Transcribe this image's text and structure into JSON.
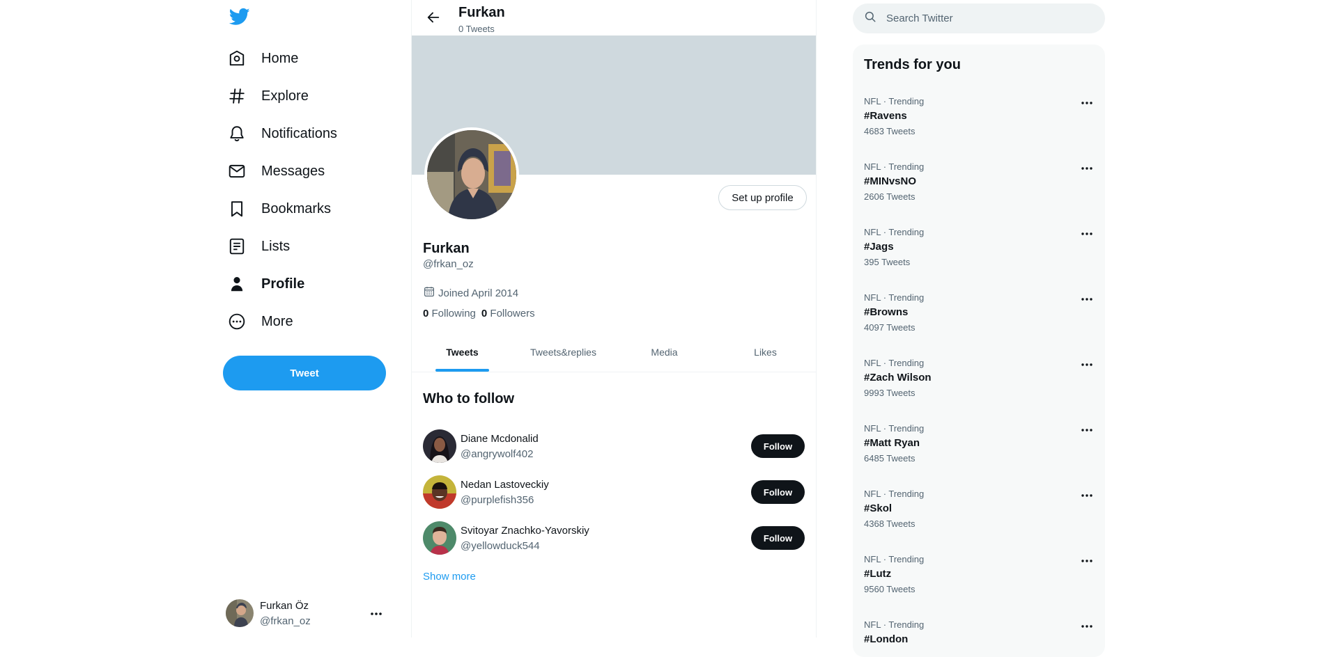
{
  "nav": {
    "items": [
      {
        "label": "Home",
        "icon": "home-icon"
      },
      {
        "label": "Explore",
        "icon": "hashtag-icon"
      },
      {
        "label": "Notifications",
        "icon": "bell-icon"
      },
      {
        "label": "Messages",
        "icon": "envelope-icon"
      },
      {
        "label": "Bookmarks",
        "icon": "bookmark-icon"
      },
      {
        "label": "Lists",
        "icon": "list-icon"
      },
      {
        "label": "Profile",
        "icon": "person-icon",
        "active": true
      },
      {
        "label": "More",
        "icon": "more-circle-icon"
      }
    ],
    "tweet_button": "Tweet"
  },
  "account": {
    "name": "Furkan Öz",
    "handle": "@frkan_oz"
  },
  "header": {
    "title": "Furkan",
    "subtitle": "0 Tweets"
  },
  "profile": {
    "setup_button": "Set up profile",
    "name": "Furkan",
    "handle": "@frkan_oz",
    "joined": "Joined April 2014",
    "following_count": "0",
    "following_label": "Following",
    "followers_count": "0",
    "followers_label": "Followers"
  },
  "tabs": [
    {
      "label": "Tweets",
      "active": true
    },
    {
      "label": "Tweets&replies"
    },
    {
      "label": "Media"
    },
    {
      "label": "Likes"
    }
  ],
  "who_to_follow": {
    "title": "Who to follow",
    "users": [
      {
        "name": "Diane Mcdonalid",
        "handle": "@angrywolf402",
        "button": "Follow"
      },
      {
        "name": "Nedan Lastoveckiy",
        "handle": "@purplefish356",
        "button": "Follow"
      },
      {
        "name": "Svitoyar Znachko-Yavorskiy",
        "handle": "@yellowduck544",
        "button": "Follow"
      }
    ],
    "show_more": "Show more"
  },
  "search": {
    "placeholder": "Search Twitter"
  },
  "trends": {
    "title": "Trends for you",
    "items": [
      {
        "meta": "NFL · Trending",
        "tag": "#Ravens",
        "count": "4683 Tweets"
      },
      {
        "meta": "NFL · Trending",
        "tag": "#MINvsNO",
        "count": "2606 Tweets"
      },
      {
        "meta": "NFL · Trending",
        "tag": "#Jags",
        "count": "395 Tweets"
      },
      {
        "meta": "NFL · Trending",
        "tag": "#Browns",
        "count": "4097 Tweets"
      },
      {
        "meta": "NFL · Trending",
        "tag": "#Zach Wilson",
        "count": "9993 Tweets"
      },
      {
        "meta": "NFL · Trending",
        "tag": "#Matt Ryan",
        "count": "6485 Tweets"
      },
      {
        "meta": "NFL · Trending",
        "tag": "#Skol",
        "count": "4368 Tweets"
      },
      {
        "meta": "NFL · Trending",
        "tag": "#Lutz",
        "count": "9560 Tweets"
      },
      {
        "meta": "NFL · Trending",
        "tag": "#London",
        "count": ""
      }
    ]
  },
  "colors": {
    "accent": "#1d9bf0",
    "text": "#0f1419",
    "muted": "#536471",
    "banner": "#cfd9de"
  }
}
